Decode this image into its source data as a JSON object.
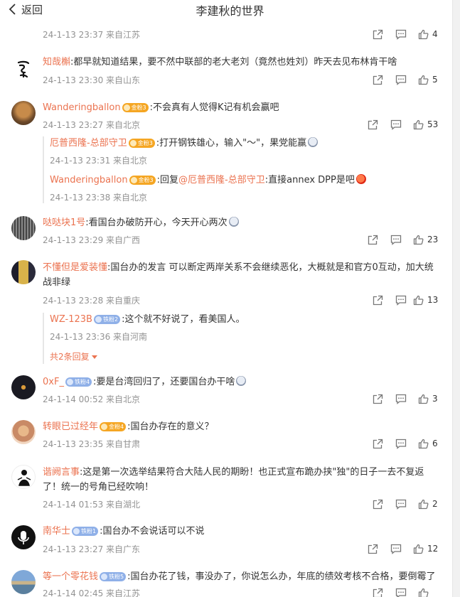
{
  "header": {
    "back_label": "返回",
    "title": "李建秋的世界"
  },
  "comments": [
    {
      "meta": "24-1-13 23:37 来自江苏",
      "likes": "4"
    },
    {
      "user": "知哉槲",
      "text": ":都早就知道结果，要不然中联部的老大老刘（竟然也姓刘）昨天去见布林肯干啥",
      "meta": "24-1-13 23:30 来自山东",
      "likes": "5"
    },
    {
      "user": "Wanderingballon",
      "badge": "金粉3",
      "text": ":不会真有人觉得K记有机会赢吧",
      "meta": "24-1-13 23:27 来自北京",
      "likes": "53",
      "replies": [
        {
          "user": "厄普西隆-总部守卫",
          "badge": "金粉3",
          "text": ":打开钢铁雄心，输入\"～\"，果党能赢",
          "meta": "24-1-13 23:31 来自北京"
        },
        {
          "user": "Wanderingballon",
          "badge": "金粉3",
          "text_prefix": ":回复",
          "mention": "@厄普西隆-总部守卫",
          "text": ":直接annex DPP是吧",
          "meta": "24-1-13 23:38 来自北京"
        }
      ]
    },
    {
      "user": "哒哒块1号",
      "text": ":看国台办破防开心，今天开心两次",
      "meta": "24-1-13 23:29 来自广西",
      "likes": "23"
    },
    {
      "user": "不懂但是爱装懂",
      "text": ":国台办的发言 可以断定两岸关系不会继续恶化，大概就是和官方0互动，加大统战非绿",
      "meta": "24-1-13 23:28 来自重庆",
      "likes": "13",
      "replies": [
        {
          "user": "WZ-123B",
          "badge": "铁粉2",
          "text": ":这个就不好说了，看美国人。",
          "meta": "24-1-13 23:36 来自河南"
        }
      ],
      "more_replies": "共2条回复"
    },
    {
      "user": "0xF_",
      "badge": "铁粉4",
      "text": ":要是台湾回归了，还要国台办干啥",
      "meta": "24-1-14 00:52 来自北京",
      "likes": "3"
    },
    {
      "user": "转眼已过经年",
      "badge": "金粉4",
      "text": ":国台办存在的意义？",
      "meta": "24-1-13 23:35 来自甘肃",
      "likes": "6"
    },
    {
      "user": "谐阙言事",
      "text": ":这是第一次选举结果符合大陆人民的期盼！也正式宣布跪办挟\"独\"的日子一去不复返了！统一的号角已经吹响！",
      "meta": "24-1-14 01:53 来自湖北",
      "likes": "2"
    },
    {
      "user": "南华士",
      "badge": "铁粉1",
      "text": ":国台办不会说话可以不说",
      "meta": "24-1-13 23:27 来自广东",
      "likes": "12"
    },
    {
      "user": "等一个零花钱",
      "badge": "铁粉5",
      "text": ":国台办花了钱，事没办了，你说怎么办，年底的绩效考核不合格，要倒霉了",
      "meta": "24-1-14 02:45 来自江苏"
    }
  ],
  "colors": {
    "username": "#eb7350",
    "meta": "#939393",
    "text": "#333333"
  },
  "icons": {
    "share": "share-icon",
    "comment": "comment-icon",
    "like": "thumbs-up-icon"
  }
}
